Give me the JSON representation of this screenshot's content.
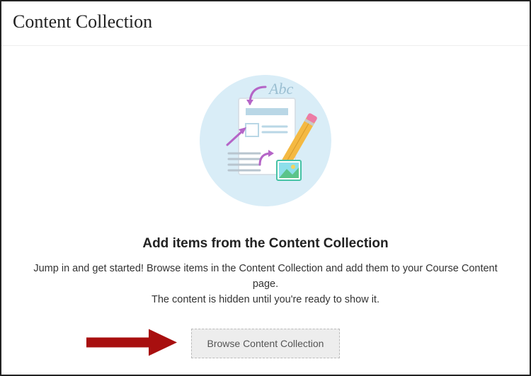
{
  "header": {
    "title": "Content Collection"
  },
  "main": {
    "heading": "Add items from the Content Collection",
    "description_line1": "Jump in and get started! Browse items in the Content Collection and add them to your Course Content page.",
    "description_line2": "The content is hidden until you're ready to show it.",
    "browse_button_label": "Browse Content Collection"
  },
  "illustration": {
    "abc_text": "Abc"
  }
}
